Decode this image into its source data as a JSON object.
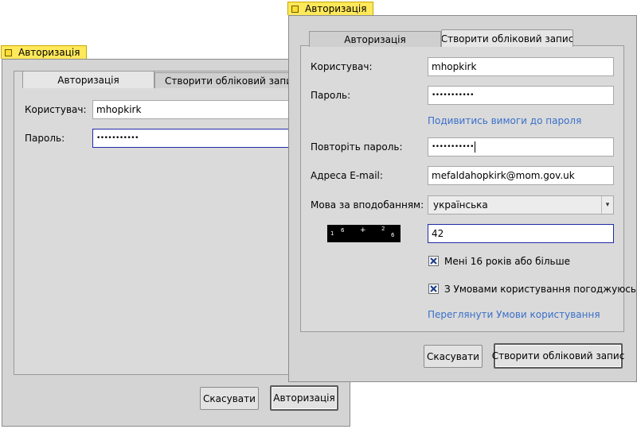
{
  "back_window": {
    "title": "Авторизація",
    "tabs": [
      {
        "label": "Авторизація",
        "active": true
      },
      {
        "label": "Створити обліковий запис",
        "active": false
      }
    ],
    "username_label": "Користувач:",
    "username_value": "mhopkirk",
    "password_label": "Пароль:",
    "password_value": "•••••••••••",
    "cancel_label": "Скасувати",
    "login_label": "Авторизація"
  },
  "front_window": {
    "title": "Авторизація",
    "tabs": [
      {
        "label": "Авторизація",
        "active": false
      },
      {
        "label": "Створити обліковий запис",
        "active": true
      }
    ],
    "username_label": "Користувач:",
    "username_value": "mhopkirk",
    "password_label": "Пароль:",
    "password_value": "•••••••••••",
    "password_requirements_link": "Подивитись вимоги до пароля",
    "repeat_password_label": "Повторіть пароль:",
    "repeat_password_value": "•••••••••••",
    "email_label": "Адреса E-mail:",
    "email_value": "mefaldahopkirk@mom.gov.uk",
    "language_label": "Мова за вподобанням:",
    "language_value": "українська",
    "captcha": {
      "n1": "1",
      "s1": "6",
      "op": "+",
      "n2": "2",
      "s2": "6"
    },
    "captcha_answer": "42",
    "age_checkbox_label": "Мені 16 років або більше",
    "age_checked": true,
    "terms_checkbox_label": "З Умовами користування погоджуюсь",
    "terms_checked": true,
    "terms_link": "Переглянути Умови користування",
    "cancel_label": "Скасувати",
    "create_label": "Створити обліковий запис"
  },
  "colors": {
    "titlebar": "#ffe85a",
    "link": "#3a6fc9",
    "focus_border": "#1f2aa8"
  }
}
